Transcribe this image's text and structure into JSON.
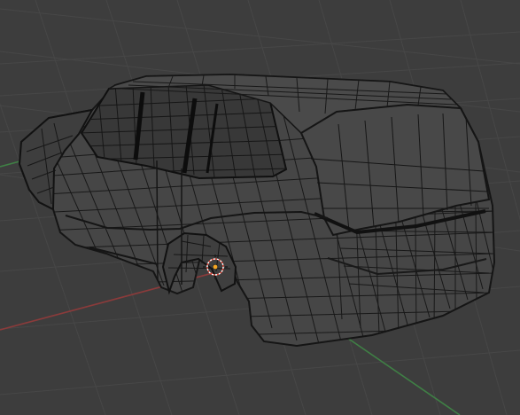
{
  "viewport": {
    "view": "3d-perspective",
    "shading": "solid-with-wireframe",
    "background_color": "#3d3d3d",
    "grid_color": "#4a4a4a",
    "x_axis_color": "#8a3b3b",
    "y_axis_color": "#3f7f45",
    "origin_color": "#f5a623"
  },
  "scene": {
    "object": {
      "type": "mesh",
      "shape": "suv-body",
      "mode": "edit",
      "surface_color": "#454545",
      "edge_color": "#111111"
    },
    "cursor": {
      "icon": "3d-cursor-icon",
      "colors": [
        "#e94b3c",
        "#ffffff"
      ]
    }
  }
}
